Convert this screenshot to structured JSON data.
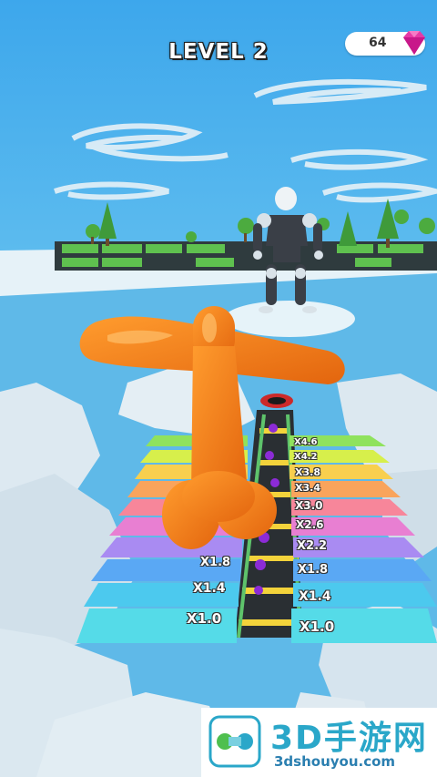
{
  "hud": {
    "level_label": "LEVEL 2",
    "gem_count": "64",
    "gem_icon": "pink-diamond-icon"
  },
  "multiplier_track": {
    "left_labels": [
      "X1.0",
      "X1.4",
      "X1.8"
    ],
    "right_labels": [
      "X1.0",
      "X1.4",
      "X1.8",
      "X2.2",
      "X2.6",
      "X3.0",
      "X3.4",
      "X3.8",
      "X4.2",
      "X4.6"
    ]
  },
  "watermark": {
    "title": "3D手游网",
    "url": "3dshouyou.com"
  },
  "colors": {
    "sky": "#4fb3ea",
    "player_orange": "#f07d1a",
    "gem_pink": "#e63aa6",
    "steps": [
      "#55dbe8",
      "#4cc9ee",
      "#5aa8f4",
      "#a98bf2",
      "#e87fd2",
      "#f7869a",
      "#f9a45c",
      "#f8cf4e",
      "#d7ef4b",
      "#8fe25d"
    ]
  }
}
